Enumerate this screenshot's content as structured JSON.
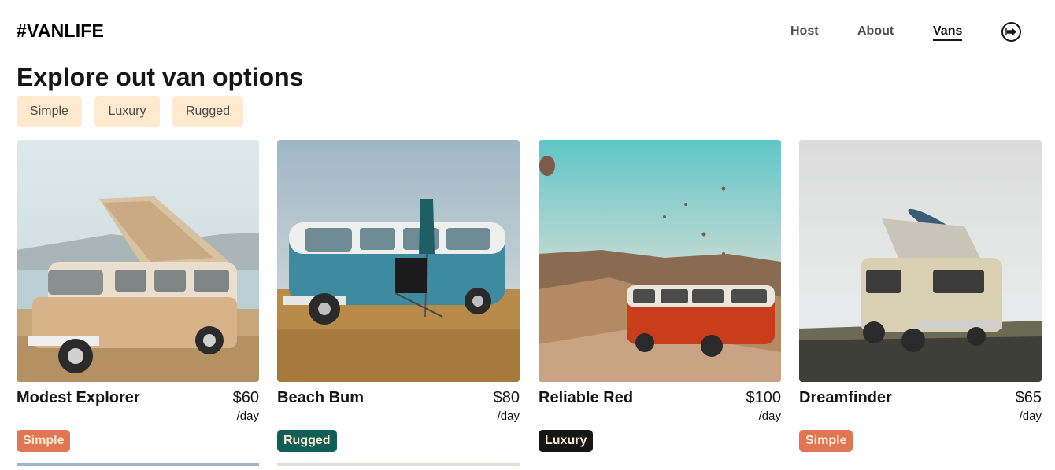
{
  "header": {
    "logo": "#VANLIFE",
    "nav": [
      {
        "label": "Host"
      },
      {
        "label": "About"
      },
      {
        "label": "Vans",
        "active": true
      }
    ],
    "logout_icon": "logout-icon"
  },
  "page": {
    "title": "Explore out van options"
  },
  "filters": [
    {
      "label": "Simple"
    },
    {
      "label": "Luxury"
    },
    {
      "label": "Rugged"
    }
  ],
  "vans": [
    {
      "name": "Modest Explorer",
      "price": "$60",
      "unit": "/day",
      "type": "Simple",
      "type_color": "#e17654"
    },
    {
      "name": "Beach Bum",
      "price": "$80",
      "unit": "/day",
      "type": "Rugged",
      "type_color": "#115e59"
    },
    {
      "name": "Reliable Red",
      "price": "$100",
      "unit": "/day",
      "type": "Luxury",
      "type_color": "#161616"
    },
    {
      "name": "Dreamfinder",
      "price": "$65",
      "unit": "/day",
      "type": "Simple",
      "type_color": "#e17654"
    }
  ],
  "colors": {
    "accent_bg": "#ffead0",
    "text": "#161616"
  }
}
